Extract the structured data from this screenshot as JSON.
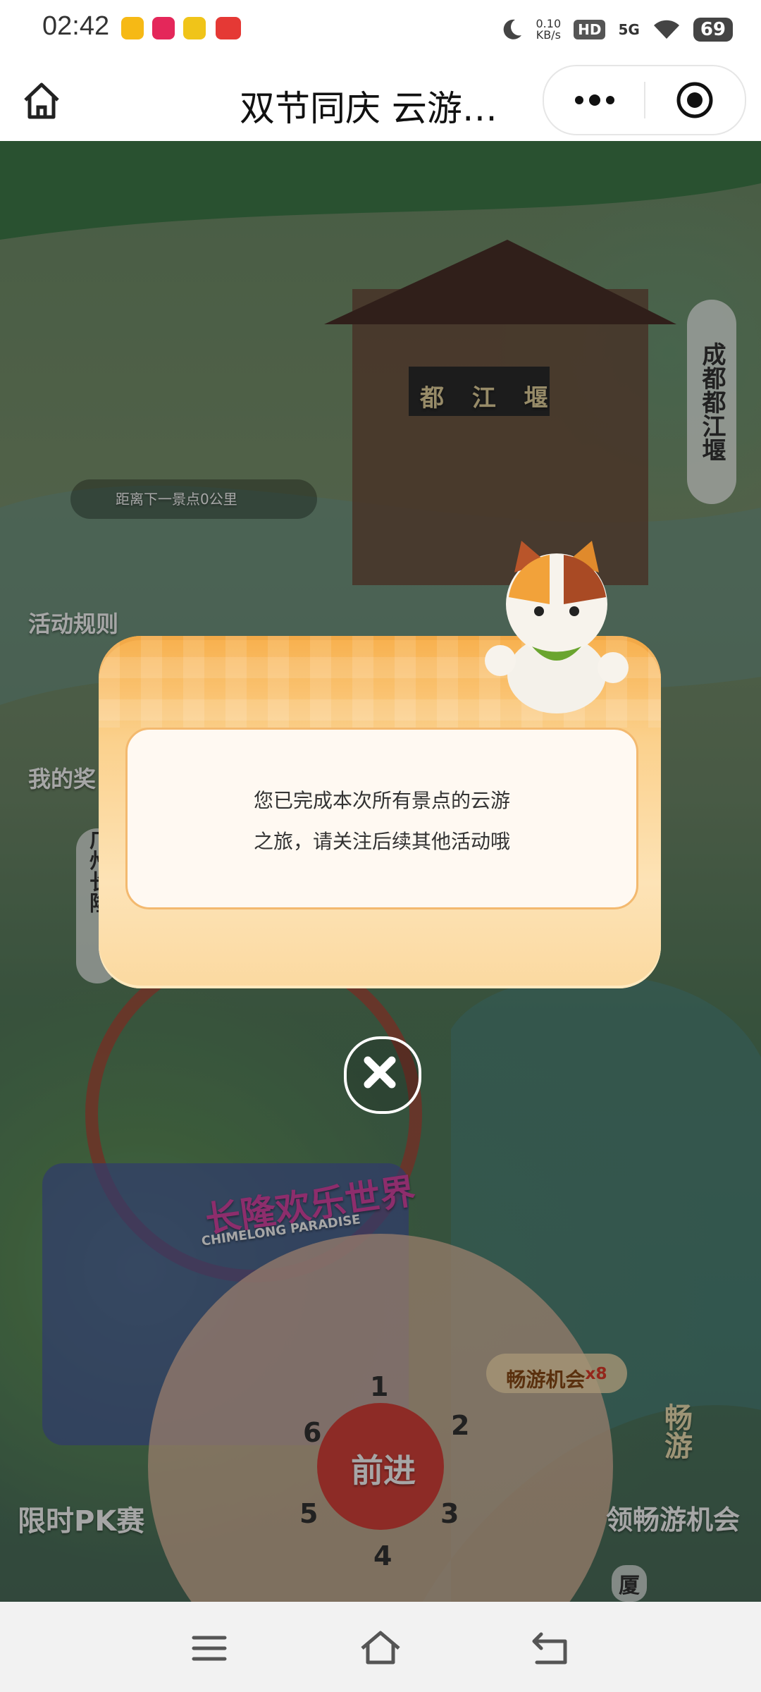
{
  "status_bar": {
    "time": "02:42",
    "net_speed_value": "0.10",
    "net_speed_unit": "KB/s",
    "hd_tag": "HD",
    "network_tag": "5G",
    "battery": "69",
    "app_icons": [
      {
        "name": "app-notification-1-icon",
        "color": "#f6b915"
      },
      {
        "name": "app-notification-2-icon",
        "color": "#e4275a"
      },
      {
        "name": "app-notification-3-icon",
        "color": "#f0c419"
      },
      {
        "name": "app-notification-4-icon",
        "color": "#e53935"
      }
    ]
  },
  "title_bar": {
    "title": "双节同庆 云游…"
  },
  "scene": {
    "landmark_sign": "都 江 堰",
    "side_location_label": "成都都江堰",
    "distance_text": "距离下一景点0公里",
    "activity_rules": "活动规则",
    "my_prizes": "我的奖",
    "left_location_label": "广州长隆",
    "park_name_cn": "长隆欢乐世界",
    "park_name_en": "CHIMELONG PARADISE",
    "chances_label": "畅游机会",
    "chances_count": "x8",
    "pk_label": "限时PK赛",
    "get_chances_label": "领畅游机会",
    "free_tour_badge": "畅游",
    "next_location_label": "厦",
    "wheel_center": "前进",
    "wheel_numbers": [
      "1",
      "2",
      "3",
      "4",
      "5",
      "6"
    ]
  },
  "modal": {
    "message_line1": "您已完成本次所有景点的云游",
    "message_line2": "之旅，请关注后续其他活动哦"
  },
  "colors": {
    "modal_orange": "#f8b04d",
    "modal_cream": "#fff9f2",
    "accent_red": "#d9433b",
    "overlay": "rgba(0,0,0,0.35)"
  }
}
